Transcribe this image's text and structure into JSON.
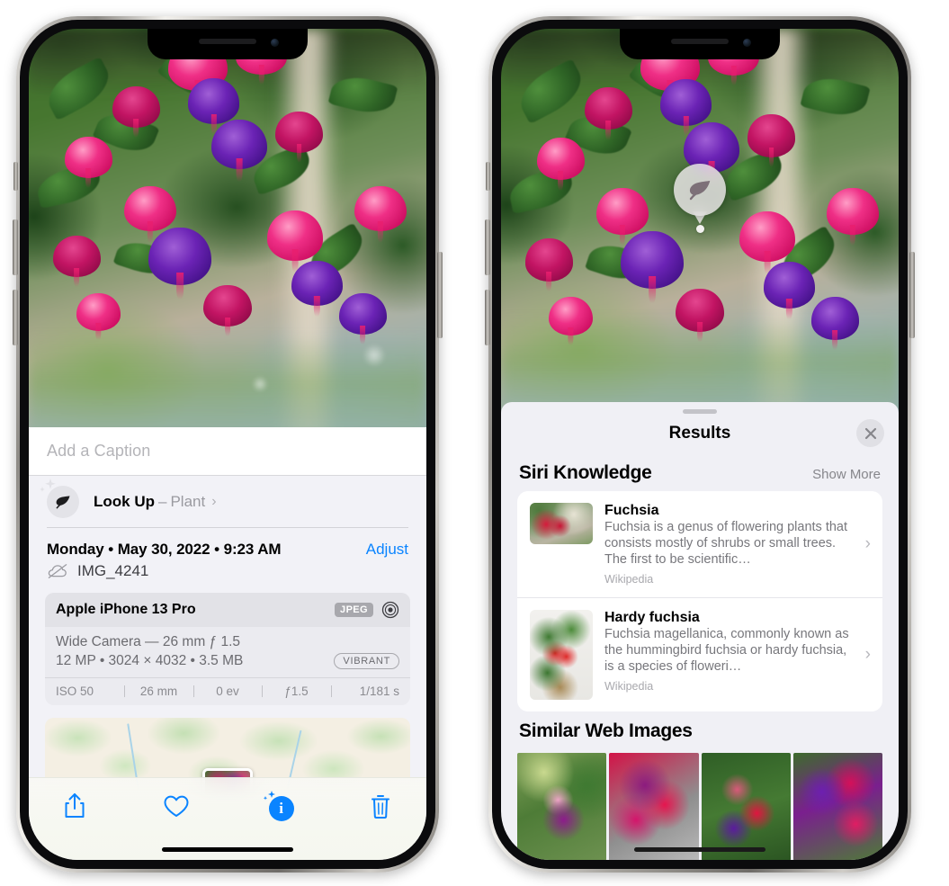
{
  "left_phone": {
    "caption_field": {
      "placeholder": "Add a Caption",
      "value": ""
    },
    "look_up": {
      "label": "Look Up",
      "separator": "–",
      "subject": "Plant",
      "chevron": "›",
      "icon": "leaf-icon"
    },
    "date_row": {
      "date_text": "Monday • May 30, 2022 • 9:23 AM",
      "adjust_label": "Adjust"
    },
    "file_row": {
      "icon": "icloud-slash-icon",
      "filename": "IMG_4241"
    },
    "exif": {
      "device": "Apple iPhone 13 Pro",
      "format_badge": "JPEG",
      "lens_icon": "aperture-icon",
      "lens_line": "Wide Camera — 26 mm ƒ 1.5",
      "size_line": "12 MP • 3024 × 4032 • 3.5 MB",
      "style_badge": "VIBRANT",
      "stats": [
        "ISO 50",
        "26 mm",
        "0 ev",
        "ƒ1.5",
        "1/181 s"
      ]
    },
    "toolbar": {
      "share_icon": "share-icon",
      "favorite_icon": "heart-icon",
      "info_icon": "info-sparkle-icon",
      "info_glyph": "i",
      "delete_icon": "trash-icon"
    }
  },
  "right_phone": {
    "vlu_badge": {
      "icon": "leaf-icon"
    },
    "sheet": {
      "title": "Results",
      "close_icon": "close-icon",
      "sections": [
        {
          "title": "Siri Knowledge",
          "action": "Show More",
          "items": [
            {
              "title": "Fuchsia",
              "description": "Fuchsia is a genus of flowering plants that consists mostly of shrubs or small trees. The first to be scientific…",
              "source": "Wikipedia",
              "chevron": "›"
            },
            {
              "title": "Hardy fuchsia",
              "description": "Fuchsia magellanica, commonly known as the hummingbird fuchsia or hardy fuchsia, is a species of floweri…",
              "source": "Wikipedia",
              "chevron": "›"
            }
          ]
        },
        {
          "title": "Similar Web Images",
          "action": "",
          "tiles": [
            "web-image-1",
            "web-image-2",
            "web-image-3",
            "web-image-4"
          ]
        }
      ]
    }
  },
  "colors": {
    "accent_blue": "#0a84ff",
    "sheet_bg": "#f0f0f5",
    "card_bg": "#ffffff",
    "secondary_text": "#86868b"
  }
}
